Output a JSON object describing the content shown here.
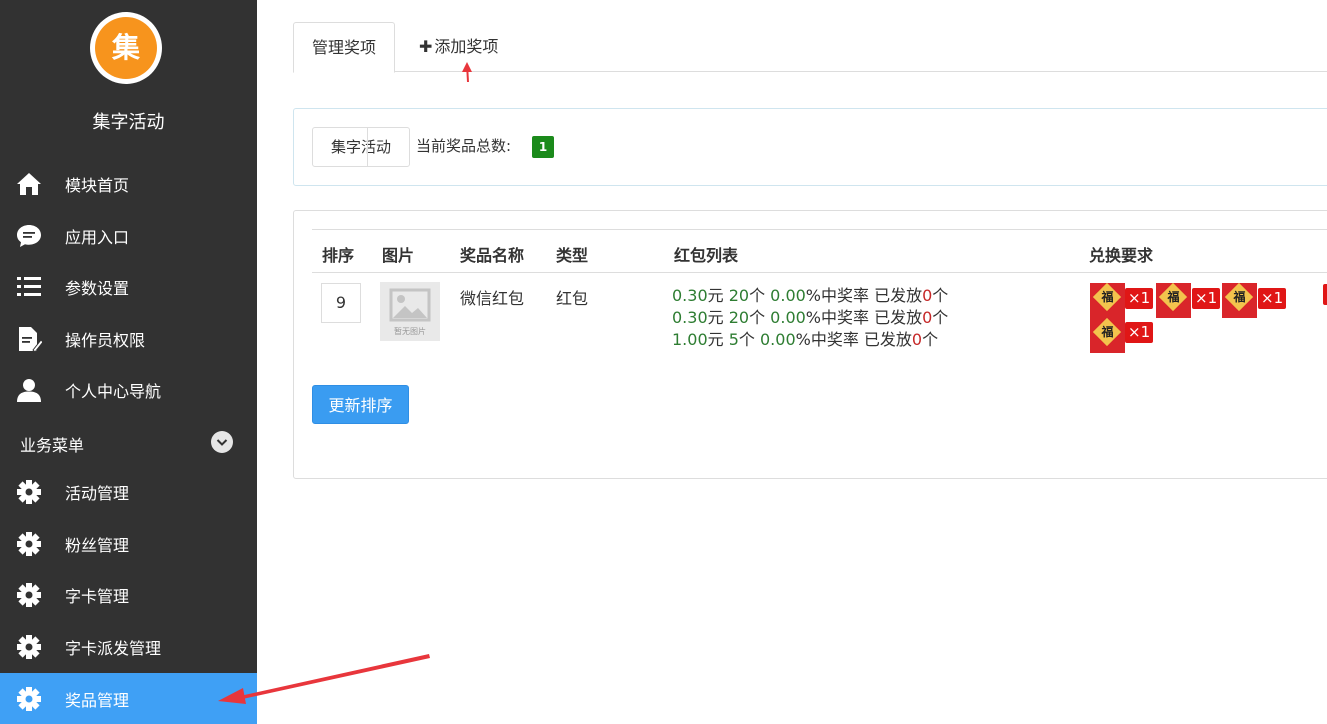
{
  "sidebar": {
    "logo_char": "集",
    "title": "集字活动",
    "items": [
      {
        "label": "模块首页",
        "icon": "home-icon"
      },
      {
        "label": "应用入口",
        "icon": "chat-icon"
      },
      {
        "label": "参数设置",
        "icon": "list-icon"
      },
      {
        "label": "操作员权限",
        "icon": "document-edit-icon"
      },
      {
        "label": "个人中心导航",
        "icon": "user-icon"
      }
    ],
    "group_title": "业务菜单",
    "group_items": [
      {
        "label": "活动管理",
        "icon": "gear-icon"
      },
      {
        "label": "粉丝管理",
        "icon": "gear-icon"
      },
      {
        "label": "字卡管理",
        "icon": "gear-icon"
      },
      {
        "label": "字卡派发管理",
        "icon": "gear-icon"
      },
      {
        "label": "奖品管理",
        "icon": "gear-icon",
        "active": true
      }
    ],
    "active_color": "#3fa0f5"
  },
  "tabs": {
    "manage": "管理奖项",
    "add_plus": "✚",
    "add": "添加奖项"
  },
  "filter": {
    "activity_button": "集字活动",
    "count_label": "当前奖品总数:",
    "count": "1",
    "badge_color": "#1b8a1b"
  },
  "table": {
    "headers": [
      "排序",
      "图片",
      "奖品名称",
      "类型",
      "红包列表",
      "兑换要求"
    ],
    "rows": [
      {
        "sort": "9",
        "image_caption": "暂无图片",
        "name": "微信红包",
        "type": "红包",
        "packets": [
          {
            "amount": "0.30",
            "unit_yuan": "元 ",
            "count": "20",
            "unit_ge": "个 ",
            "rate": "0.00",
            "rate_suffix": "%中奖率 已发放",
            "issued": "0",
            "issued_suffix": "个"
          },
          {
            "amount": "0.30",
            "unit_yuan": "元 ",
            "count": "20",
            "unit_ge": "个 ",
            "rate": "0.00",
            "rate_suffix": "%中奖率 已发放",
            "issued": "0",
            "issued_suffix": "个"
          },
          {
            "amount": "1.00",
            "unit_yuan": "元 ",
            "count": "5",
            "unit_ge": "个 ",
            "rate": "0.00",
            "rate_suffix": "%中奖率 已发放",
            "issued": "0",
            "issued_suffix": "个"
          }
        ],
        "requirements": [
          {
            "char": "福",
            "qty": "×1"
          },
          {
            "char": "福",
            "qty": "×1"
          },
          {
            "char": "福",
            "qty": "×1"
          },
          {
            "char": "福",
            "qty": "×1"
          }
        ]
      }
    ]
  },
  "update_button": "更新排序",
  "colors": {
    "sidebar_bg": "#323232",
    "primary": "#3a9cf1",
    "annotation_arrow": "#e8363c"
  }
}
